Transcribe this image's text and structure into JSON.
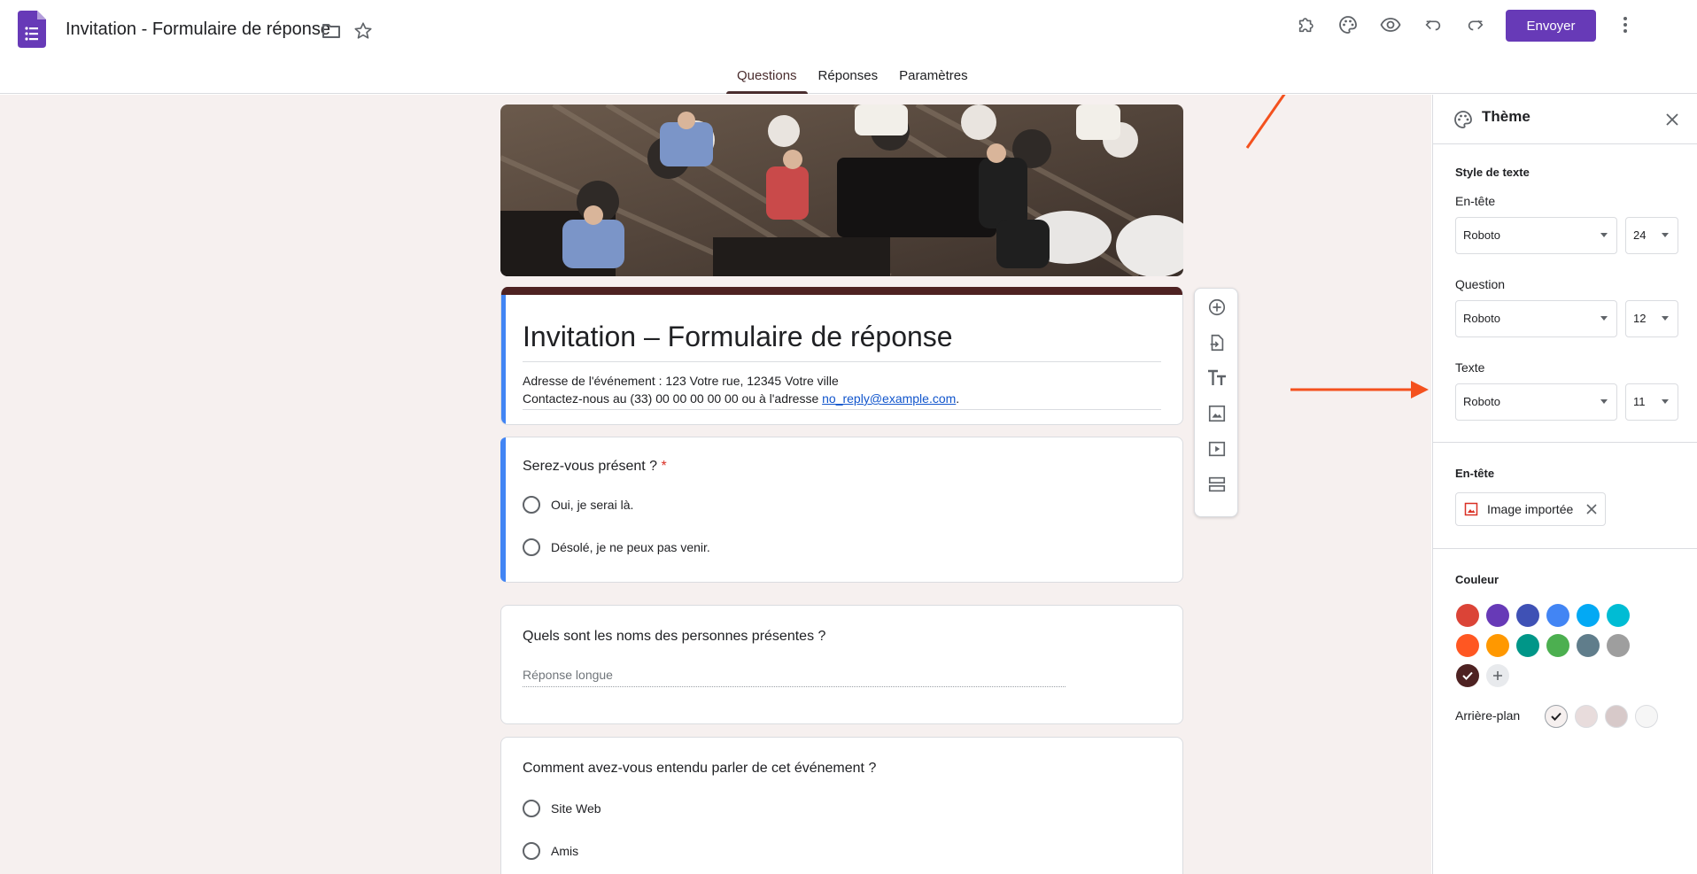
{
  "app": {
    "doc_title": "Invitation - Formulaire de réponse",
    "send_label": "Envoyer",
    "tabs": [
      {
        "label": "Questions",
        "active": true
      },
      {
        "label": "Réponses",
        "active": false
      },
      {
        "label": "Paramètres",
        "active": false
      }
    ],
    "top_icons": [
      "puzzle-icon",
      "palette-icon",
      "eye-icon",
      "undo-icon",
      "redo-icon",
      "more-vert-icon"
    ],
    "accent_color": "#673ab7"
  },
  "form": {
    "title": "Invitation – Formulaire de réponse",
    "description_line1": "Adresse de l'événement : 123 Votre rue, 12345 Votre ville",
    "description_line2_prefix": "Contactez-nous au (33) 00 00 00 00 00 ou à l'adresse ",
    "description_email": "no_reply@example.com",
    "description_line2_suffix": ".",
    "questions": [
      {
        "title": "Serez-vous présent ?",
        "required_mark": "*",
        "options": [
          "Oui, je serai là.",
          "Désolé, je ne peux pas venir."
        ]
      },
      {
        "title": "Quels sont les noms des personnes présentes ?",
        "placeholder": "Réponse longue"
      },
      {
        "title": "Comment avez-vous entendu parler de cet événement ?",
        "options": [
          "Site Web",
          "Amis"
        ]
      }
    ]
  },
  "floating_toolbar": [
    "add-question-icon",
    "import-questions-icon",
    "add-title-icon",
    "add-image-icon",
    "add-video-icon",
    "add-section-icon"
  ],
  "theme_panel": {
    "title": "Thème",
    "text_style": {
      "section_title": "Style de texte",
      "header": {
        "label": "En-tête",
        "font": "Roboto",
        "size": "24"
      },
      "question": {
        "label": "Question",
        "font": "Roboto",
        "size": "12"
      },
      "text": {
        "label": "Texte",
        "font": "Roboto",
        "size": "11"
      }
    },
    "header_section": {
      "title": "En-tête",
      "chip_label": "Image importée"
    },
    "color_section": {
      "title": "Couleur",
      "colors": [
        "#db4437",
        "#673ab7",
        "#3f51b5",
        "#4285f4",
        "#03a9f4",
        "#00bcd4",
        "#ff5722",
        "#ff9800",
        "#009688",
        "#4caf50",
        "#607d8b",
        "#9e9e9e",
        "#4e2222"
      ],
      "selected_color": "#4e2222",
      "background_label": "Arrière-plan",
      "backgrounds": [
        "#f6f0ef",
        "#e8dcdc",
        "#d7c9c9",
        "#f6f6f6"
      ]
    }
  }
}
